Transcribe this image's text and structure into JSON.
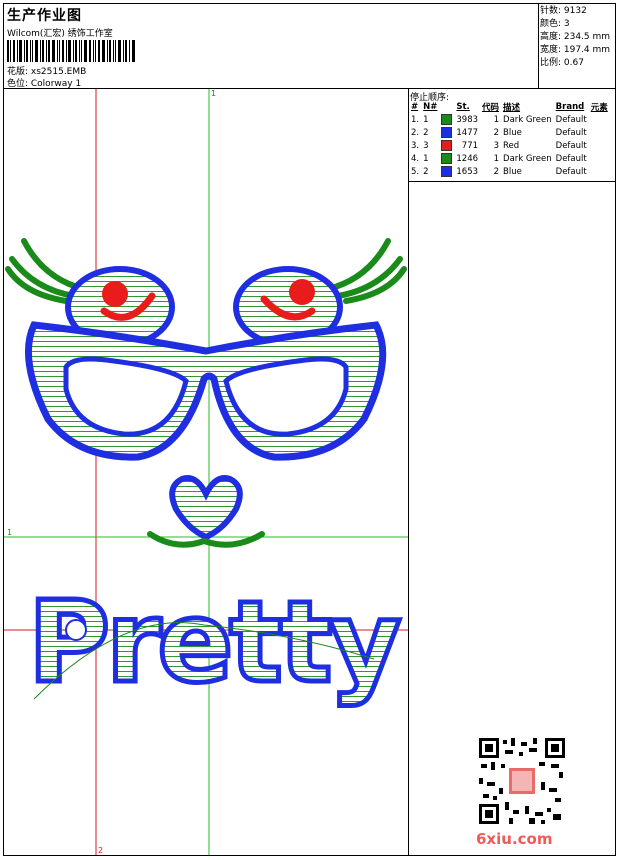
{
  "header": {
    "title": "生产作业图",
    "company": "Wilcom(汇宏) 绣饰工作室",
    "design_label": "花版: xs2515.EMB",
    "colorway_label": "色位: Colorway 1"
  },
  "stats": {
    "stitches": "针数: 9132",
    "colors": "颜色: 3",
    "height": "高度: 234.5 mm",
    "width": "宽度: 197.4 mm",
    "scale": "比例: 0.67"
  },
  "stop_sequence": {
    "title": "停止顺序:",
    "headers": [
      "#",
      "N#",
      "St.",
      "代码",
      "描述",
      "Brand",
      "元素"
    ],
    "rows": [
      {
        "idx": "1.",
        "n": "1",
        "color": "#1a8a1a",
        "st": "3983",
        "code": "1",
        "desc": "Dark Green",
        "brand": "Default"
      },
      {
        "idx": "2.",
        "n": "2",
        "color": "#1f2ee0",
        "st": "1477",
        "code": "2",
        "desc": "Blue",
        "brand": "Default"
      },
      {
        "idx": "3.",
        "n": "3",
        "color": "#e81c1c",
        "st": "771",
        "code": "3",
        "desc": "Red",
        "brand": "Default"
      },
      {
        "idx": "4.",
        "n": "1",
        "color": "#1a8a1a",
        "st": "1246",
        "code": "1",
        "desc": "Dark Green",
        "brand": "Default"
      },
      {
        "idx": "5.",
        "n": "2",
        "color": "#1f2ee0",
        "st": "1653",
        "code": "2",
        "desc": "Blue",
        "brand": "Default"
      }
    ]
  },
  "guides": {
    "v_green_label": "1",
    "h_green_label": "1",
    "v_red_label": "2",
    "h_red_label": "2"
  },
  "design_text": "Pretty",
  "watermark": {
    "part1": "6xiu",
    "part2": ".com"
  },
  "colors": {
    "green": "#1a8a1a",
    "blue": "#1f2ee0",
    "red": "#e81c1c",
    "guide_green": "#22c022",
    "guide_red": "#d21c1c"
  }
}
